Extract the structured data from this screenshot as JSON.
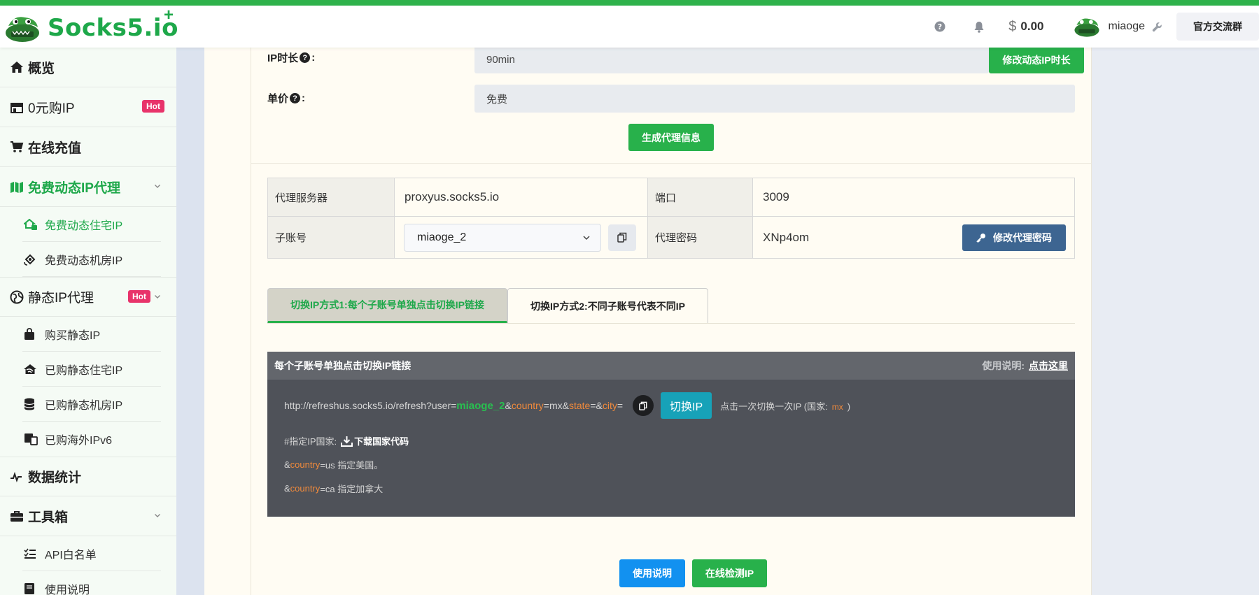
{
  "header": {
    "brand": "Socks5.io",
    "brand_plus": "+",
    "balance_symbol": "$",
    "balance": "0.00",
    "username": "miaoge",
    "group_button": "官方交流群",
    "icons": [
      "help-circle-icon",
      "bell-icon",
      "dollar-icon",
      "wrench-icon"
    ]
  },
  "sidebar": {
    "overview": "概览",
    "zero_buy": "0元购IP",
    "zero_buy_badge": "Hot",
    "recharge": "在线充值",
    "free_dynamic": "免费动态IP代理",
    "free_dynamic_sub": [
      "免费动态住宅IP",
      "免费动态机房IP"
    ],
    "static": "静态IP代理",
    "static_badge": "Hot",
    "static_sub": [
      "购买静态IP",
      "已购静态住宅IP",
      "已购静态机房IP",
      "已购海外IPv6"
    ],
    "stats": "数据统计",
    "toolbox": "工具箱",
    "toolbox_sub": [
      "API白名单",
      "使用说明"
    ]
  },
  "form": {
    "ip_duration_label": "IP时长",
    "ip_duration_value": "90min",
    "ip_duration_button": "修改动态IP时长",
    "price_label": "单价",
    "price_value": "免费",
    "generate_button": "生成代理信息",
    "colon": ":"
  },
  "info": {
    "server_label": "代理服务器",
    "server_value": "proxyus.socks5.io",
    "port_label": "端口",
    "port_value": "3009",
    "subaccount_label": "子账号",
    "subaccount_value": "miaoge_2",
    "password_label": "代理密码",
    "password_value": "XNp4om",
    "password_button": "修改代理密码"
  },
  "tabs": {
    "tab1": "切换IP方式1:每个子账号单独点击切换IP链接",
    "tab2": "切换IP方式2:不同子账号代表不同IP"
  },
  "panel": {
    "title": "每个子账号单独点击切换IP链接",
    "help_label": "使用说明:",
    "help_link": "点击这里",
    "url_prefix": "http://refreshus.socks5.io/refresh?user=",
    "url_user": "miaoge_2",
    "amp": "&",
    "kw_country": "country",
    "url_country_value": "=mx&",
    "kw_state": "state",
    "url_state_value": "=&",
    "kw_city": "city",
    "eq": "=",
    "switch_button": "切换IP",
    "note_prefix": "点击一次切换一次IP (国家:",
    "note_country": "mx",
    "note_suffix": ")",
    "hint_label": "#指定IP国家:",
    "hint_download": "下载国家代码",
    "example1_suffix": "=us 指定美国。",
    "example2_suffix": "=ca 指定加拿大"
  },
  "bottom": {
    "manual_button": "使用说明",
    "check_button": "在线检测IP"
  },
  "colors": {
    "brand_green": "#28b14b",
    "hot_pink": "#e8336a",
    "info_blue": "#17a2b8",
    "steel_blue": "#3d6591"
  }
}
